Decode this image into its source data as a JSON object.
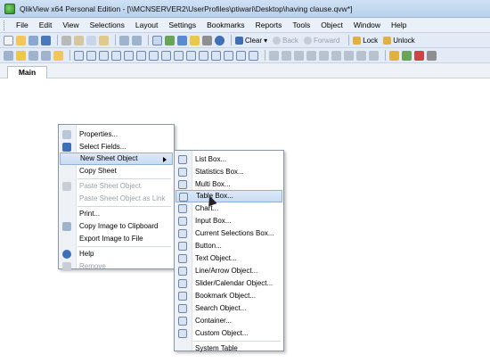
{
  "window": {
    "title": "QlikView x64 Personal Edition - [\\\\MCNSERVER2\\UserProfiles\\ptiwari\\Desktop\\having clause.qvw*]"
  },
  "menubar": [
    "File",
    "Edit",
    "View",
    "Selections",
    "Layout",
    "Settings",
    "Bookmarks",
    "Reports",
    "Tools",
    "Object",
    "Window",
    "Help"
  ],
  "toolbar": {
    "clear": "Clear",
    "back": "Back",
    "forward": "Forward",
    "lock": "Lock",
    "unlock": "Unlock"
  },
  "tabs": [
    {
      "label": "Main"
    }
  ],
  "context_menu": {
    "items": [
      {
        "label": "Properties..."
      },
      {
        "label": "Select Fields..."
      },
      {
        "label": "New Sheet Object"
      },
      {
        "label": "Copy Sheet"
      },
      {
        "label": "Paste Sheet Object"
      },
      {
        "label": "Paste Sheet Object as Link"
      },
      {
        "label": "Print..."
      },
      {
        "label": "Copy Image to Clipboard"
      },
      {
        "label": "Export Image to File"
      },
      {
        "label": "Help"
      },
      {
        "label": "Remove"
      }
    ]
  },
  "submenu": {
    "items": [
      {
        "label": "List Box..."
      },
      {
        "label": "Statistics Box..."
      },
      {
        "label": "Multi Box..."
      },
      {
        "label": "Table Box..."
      },
      {
        "label": "Chart..."
      },
      {
        "label": "Input Box..."
      },
      {
        "label": "Current Selections Box..."
      },
      {
        "label": "Button..."
      },
      {
        "label": "Text Object..."
      },
      {
        "label": "Line/Arrow Object..."
      },
      {
        "label": "Slider/Calendar Object..."
      },
      {
        "label": "Bookmark Object..."
      },
      {
        "label": "Search Object..."
      },
      {
        "label": "Container..."
      },
      {
        "label": "Custom Object..."
      },
      {
        "label": "System Table"
      }
    ]
  },
  "colors": {
    "highlight": "#c8dcf2",
    "titlebar": "#b9d1ec",
    "icon_blue": "#3f6fb5"
  }
}
